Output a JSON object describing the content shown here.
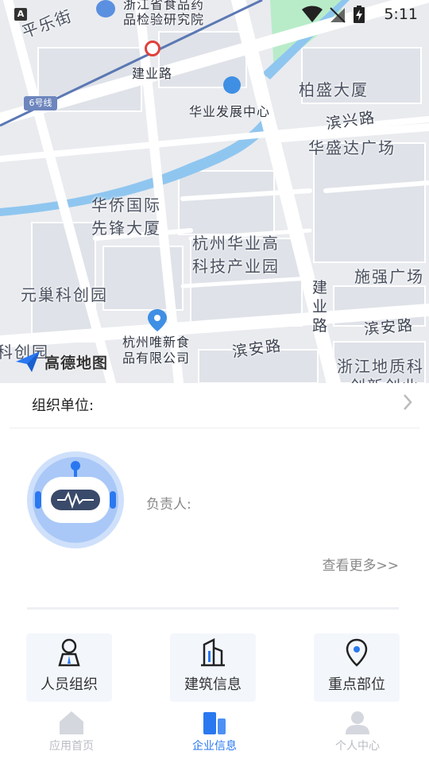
{
  "status_bar": {
    "time": "5:11",
    "notification_badge": "A",
    "icons": [
      "wifi-icon",
      "signal-icon",
      "battery-charging-icon"
    ]
  },
  "map": {
    "labels": {
      "pingle_street": "平乐街",
      "zhejiang_institute_line1": "浙江省食品药",
      "zhejiang_institute_line2": "品检验研究院",
      "jianye_road_top": "建业路",
      "metro_line": "6号线",
      "huaye_center": "华业发展中心",
      "baisheng_building": "柏盛大厦",
      "binxing_road": "滨兴路",
      "huashengda_plaza": "华盛达广场",
      "huaqiao_line1": "华侨国际",
      "huaqiao_line2": "先锋大厦",
      "hangzhou_huaye_line1": "杭州华业高",
      "hangzhou_huaye_line2": "科技产业园",
      "shiqiang_plaza": "施强广场",
      "yuanchao_park": "元巢科创园",
      "jianye_road_vertical": "建业路",
      "binan_road_right": "滨安路",
      "weixin_food_line1": "杭州唯新食",
      "weixin_food_line2": "品有限公司",
      "binan_road_mid": "滨安路",
      "left_partial": "科创园",
      "zhejiang_geology_line1": "浙江地质科",
      "zhejiang_geology_line2": "创新创业"
    },
    "logo_text": "高德地图",
    "colors": {
      "land": "#e9ebef",
      "road": "#ffffff",
      "water": "#8fc6ef",
      "green": "#b8ecc9",
      "metro": "#5b78b4"
    }
  },
  "org": {
    "label": "组织单位:"
  },
  "manager": {
    "label": "负责人:",
    "more_link": "查看更多>>"
  },
  "tiles": [
    {
      "label": "人员组织",
      "icon": "person-icon"
    },
    {
      "label": "建筑信息",
      "icon": "building-icon"
    },
    {
      "label": "重点部位",
      "icon": "location-pin-icon"
    }
  ],
  "nav": {
    "items": [
      {
        "label": "应用首页",
        "icon": "home-icon",
        "active": false
      },
      {
        "label": "企业信息",
        "icon": "enterprise-icon",
        "active": true
      },
      {
        "label": "个人中心",
        "icon": "user-icon",
        "active": false
      }
    ],
    "colors": {
      "active": "#2a78f0",
      "inactive": "#b8bcc4"
    }
  }
}
